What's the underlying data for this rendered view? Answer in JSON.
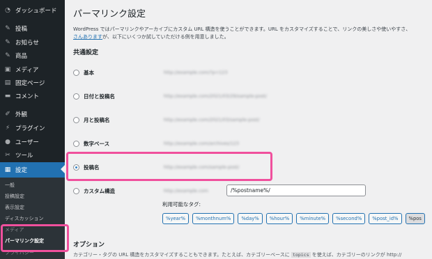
{
  "sidebar": {
    "items": [
      {
        "label": "ダッシュボード",
        "icon": "dashboard-icon",
        "glyph": "◔"
      },
      {
        "label": "投稿",
        "icon": "pin-icon",
        "glyph": "✎"
      },
      {
        "label": "お知らせ",
        "icon": "pin-icon",
        "glyph": "✎"
      },
      {
        "label": "商品",
        "icon": "pin-icon",
        "glyph": "✎"
      },
      {
        "label": "メディア",
        "icon": "media-icon",
        "glyph": "▣"
      },
      {
        "label": "固定ページ",
        "icon": "page-icon",
        "glyph": "▤"
      },
      {
        "label": "コメント",
        "icon": "comment-icon",
        "glyph": "▬"
      },
      {
        "label": "外観",
        "icon": "brush-icon",
        "glyph": "✐"
      },
      {
        "label": "プラグイン",
        "icon": "plugin-icon",
        "glyph": "⚡"
      },
      {
        "label": "ユーザー",
        "icon": "user-icon",
        "glyph": "●"
      },
      {
        "label": "ツール",
        "icon": "wrench-icon",
        "glyph": "✂"
      },
      {
        "label": "設定",
        "icon": "settings-icon",
        "glyph": "▦"
      }
    ],
    "submenu": [
      "一般",
      "投稿設定",
      "表示設定",
      "ディスカッション",
      "メディア",
      "パーマリンク設定",
      "プライバシー"
    ]
  },
  "main": {
    "title": "パーマリンク設定",
    "intro_line1": "WordPress ではパーマリンクやアーカイブにカスタム URL 構造を使うことができます。URL をカスタマイズすることで、リンクの美しさや使いやすさ、",
    "intro_link": "さんあります",
    "intro_line2_rest": "が、以下にいくつか試していただける例を用意しました。",
    "common_settings": "共通設定",
    "options": [
      {
        "label": "基本",
        "url": "http://example.com/?p=123",
        "checked": false
      },
      {
        "label": "日付と投稿名",
        "url": "http://example.com/2021/03/29/sample-post/",
        "checked": false
      },
      {
        "label": "月と投稿名",
        "url": "http://example.com/2021/03/sample-post/",
        "checked": false
      },
      {
        "label": "数字ベース",
        "url": "http://example.com/archives/123",
        "checked": false
      },
      {
        "label": "投稿名",
        "url": "http://example.com/sample-post/",
        "checked": true
      },
      {
        "label": "カスタム構造",
        "url": "http://example.com",
        "checked": false
      }
    ],
    "custom_value": "/%postname%/",
    "available_tags_label": "利用可能なタグ:",
    "tags": [
      "%year%",
      "%monthnum%",
      "%day%",
      "%hour%",
      "%minute%",
      "%second%",
      "%post_id%",
      "%pos"
    ],
    "options_title": "オプション",
    "options_text_start": "カテゴリー・タグの URL 構造をカスタマイズすることもできます。たとえば、カテゴリーベースに",
    "options_code": "topics",
    "options_text_end": "を使えば、カテゴリーのリンクが http://"
  },
  "colors": {
    "sidebar_bg": "#1d2327",
    "accent": "#2271b1",
    "highlight": "#f0509d"
  }
}
